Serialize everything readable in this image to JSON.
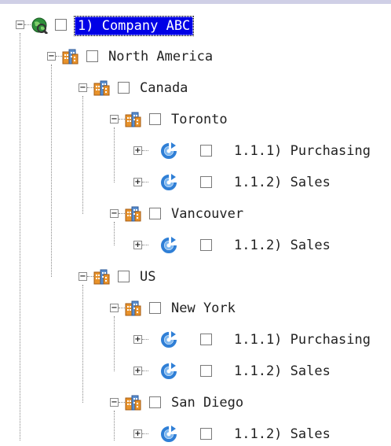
{
  "tree": {
    "root": {
      "label": "1) Company ABC",
      "icon": "globe-icon",
      "expander": "−",
      "selected": true
    },
    "north_america": {
      "label": "North America",
      "icon": "building-icon",
      "expander": "−"
    },
    "canada": {
      "label": "Canada",
      "icon": "building-icon",
      "expander": "−"
    },
    "toronto": {
      "label": "Toronto",
      "icon": "building-icon",
      "expander": "−"
    },
    "toronto_purchasing": {
      "label": "1.1.1) Purchasing",
      "icon": "department-icon",
      "expander": "+"
    },
    "toronto_sales": {
      "label": "1.1.2) Sales",
      "icon": "department-icon",
      "expander": "+"
    },
    "vancouver": {
      "label": "Vancouver",
      "icon": "building-icon",
      "expander": "−"
    },
    "vancouver_sales": {
      "label": "1.1.2) Sales",
      "icon": "department-icon",
      "expander": "+"
    },
    "us": {
      "label": "US",
      "icon": "building-icon",
      "expander": "−"
    },
    "new_york": {
      "label": "New York",
      "icon": "building-icon",
      "expander": "−"
    },
    "new_york_purchasing": {
      "label": "1.1.1) Purchasing",
      "icon": "department-icon",
      "expander": "+"
    },
    "new_york_sales": {
      "label": "1.1.2) Sales",
      "icon": "department-icon",
      "expander": "+"
    },
    "san_diego": {
      "label": "San Diego",
      "icon": "building-icon",
      "expander": "−"
    },
    "san_diego_sales": {
      "label": "1.1.2) Sales",
      "icon": "department-icon",
      "expander": "+"
    }
  },
  "colors": {
    "selection": "#0000e6",
    "building": "#e8922a",
    "department": "#2f7fd6"
  }
}
